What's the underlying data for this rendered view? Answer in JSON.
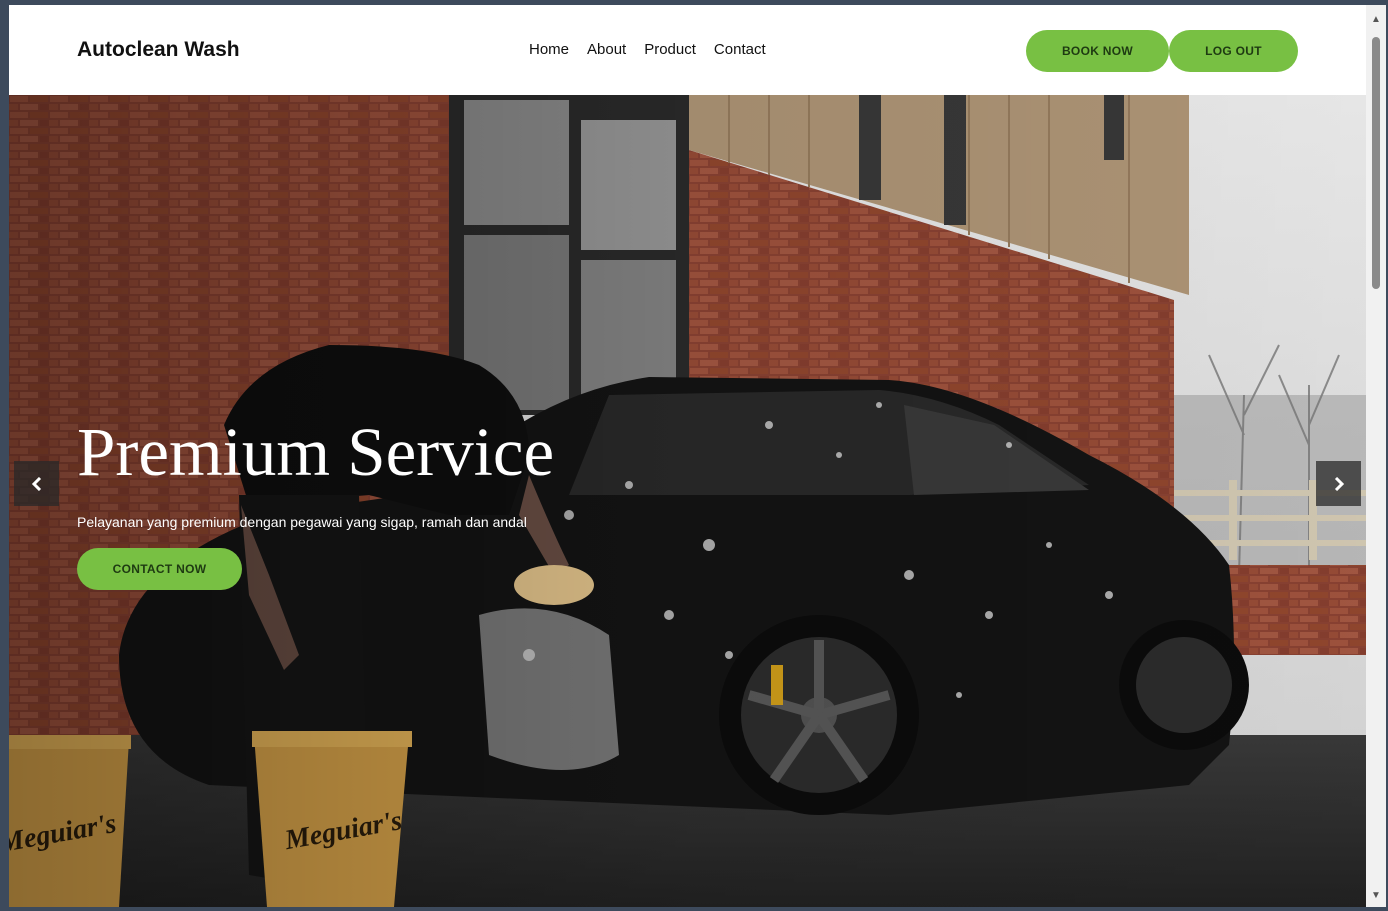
{
  "brand": "Autoclean Wash",
  "nav": {
    "home": "Home",
    "about": "About",
    "product": "Product",
    "contact": "Contact"
  },
  "actions": {
    "book": "BOOK NOW",
    "logout": "LOG OUT",
    "contact": "CONTACT NOW"
  },
  "hero": {
    "title": "Premium Service",
    "subtitle": "Pelayanan yang premium dengan pegawai yang sigap, ramah dan andal",
    "image_subject": "man washing black car with foam beside brick building, yellow buckets"
  },
  "colors": {
    "accent": "#78c043",
    "accent_text": "#1e3a12",
    "window_frame": "#3d4a5c"
  },
  "icons": {
    "prev": "chevron-left-icon",
    "next": "chevron-right-icon"
  }
}
